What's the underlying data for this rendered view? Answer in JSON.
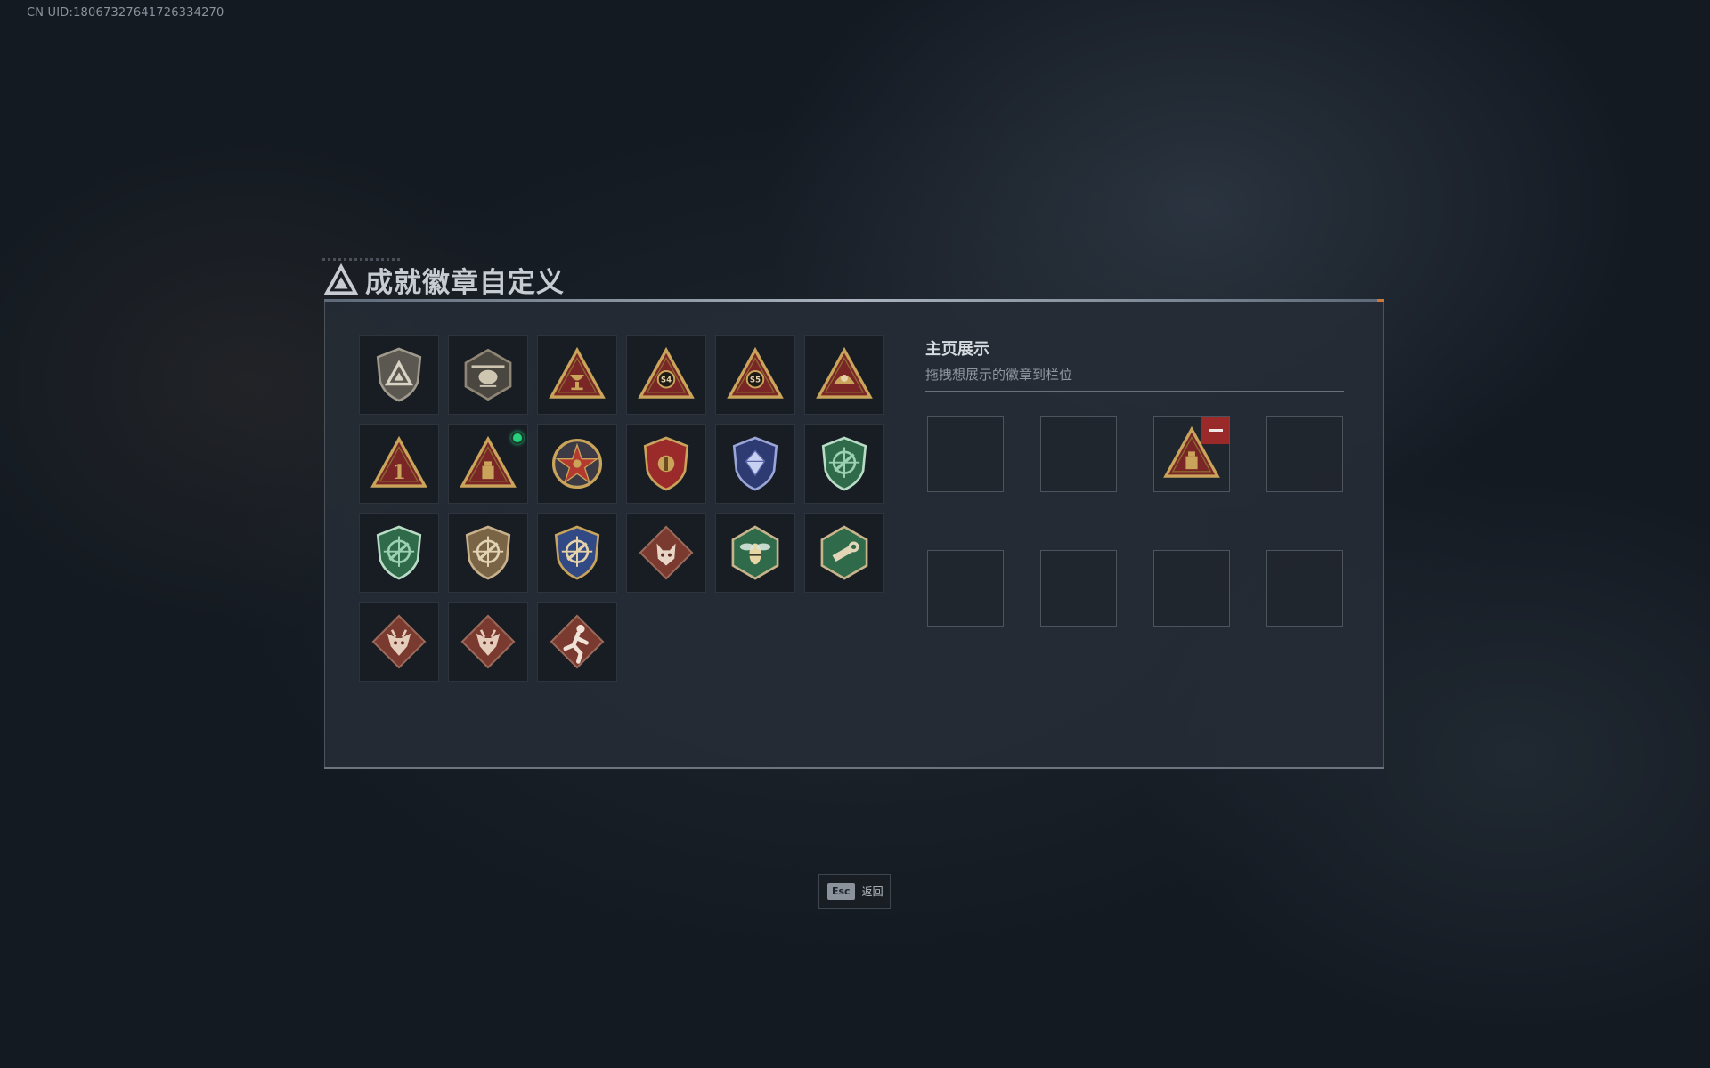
{
  "uid": "CN UID:18067327641726334270",
  "title": "成就徽章自定义",
  "display": {
    "title": "主页展示",
    "subtitle": "拖拽想展示的徽章到栏位"
  },
  "badges": [
    {
      "icon": "gray-triangle-shield-badge-icon"
    },
    {
      "icon": "helicopter-badge-icon"
    },
    {
      "icon": "gold-triangle-chalice-badge-icon"
    },
    {
      "icon": "gold-triangle-s4-badge-icon",
      "text": "S4"
    },
    {
      "icon": "gold-triangle-s5-badge-icon",
      "text": "S5"
    },
    {
      "icon": "gold-triangle-leaf-badge-icon"
    },
    {
      "icon": "gold-triangle-number-one-badge-icon",
      "text": "1"
    },
    {
      "icon": "gold-triangle-box-badge-icon",
      "new": true
    },
    {
      "icon": "red-star-medal-badge-icon"
    },
    {
      "icon": "blue-red-shield-crest-badge-icon"
    },
    {
      "icon": "blue-diamond-shield-badge-icon"
    },
    {
      "icon": "green-crosshair-rifle-badge-icon"
    },
    {
      "icon": "green-crosshair-shield-badge-icon"
    },
    {
      "icon": "bronze-crosshair-shield-badge-icon"
    },
    {
      "icon": "gold-blue-crosshair-crest-badge-icon"
    },
    {
      "icon": "wolf-diamond-badge-icon"
    },
    {
      "icon": "hornet-hexagon-badge-icon"
    },
    {
      "icon": "wrench-hexagon-badge-icon"
    },
    {
      "icon": "dragon-diamond-badge-icon"
    },
    {
      "icon": "dragon-diamond-badge-icon"
    },
    {
      "icon": "runner-diamond-badge-icon"
    }
  ],
  "slots": [
    {
      "filled": false
    },
    {
      "filled": false
    },
    {
      "filled": true,
      "icon": "gold-triangle-box-badge-icon"
    },
    {
      "filled": false
    },
    {
      "filled": false
    },
    {
      "filled": false
    },
    {
      "filled": false
    },
    {
      "filled": false
    }
  ],
  "esc": {
    "key": "Esc",
    "label": "返回"
  },
  "colors": {
    "accent_orange": "#c9783e",
    "new_dot": "#26d07c",
    "remove": "#9a2a2a"
  }
}
